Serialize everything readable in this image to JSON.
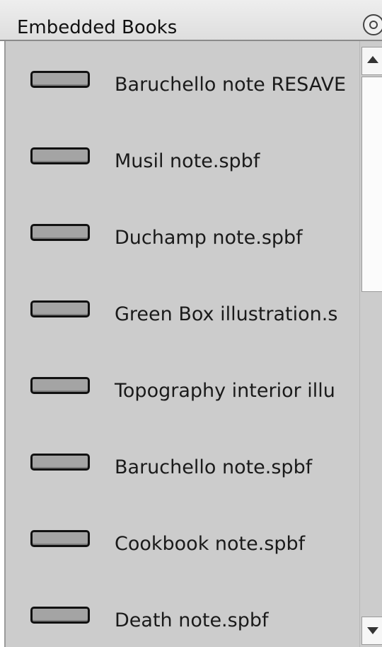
{
  "header": {
    "title": "Embedded Books",
    "options_icon": "target-icon"
  },
  "books": [
    {
      "label": "Baruchello note RESAVE",
      "icon": "book-icon"
    },
    {
      "label": "Musil note.spbf",
      "icon": "book-icon"
    },
    {
      "label": "Duchamp note.spbf",
      "icon": "book-icon"
    },
    {
      "label": "Green Box illustration.s",
      "icon": "book-icon"
    },
    {
      "label": "Topography interior illu",
      "icon": "book-icon"
    },
    {
      "label": "Baruchello note.spbf",
      "icon": "book-icon"
    },
    {
      "label": "Cookbook note.spbf",
      "icon": "book-icon"
    },
    {
      "label": "Death note.spbf",
      "icon": "book-icon"
    }
  ],
  "scrollbar": {
    "up_icon": "arrow-up-icon",
    "down_icon": "arrow-down-icon"
  }
}
